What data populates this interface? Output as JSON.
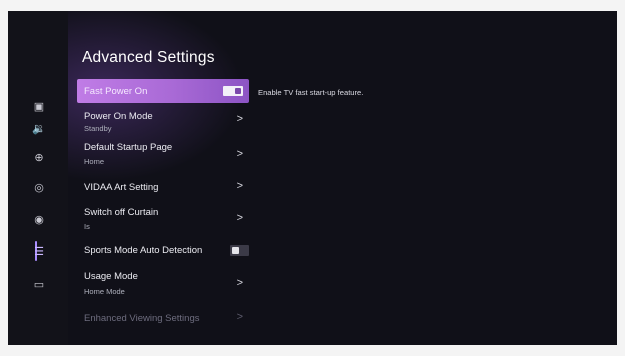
{
  "page": {
    "title": "Advanced Settings",
    "help_text": "Enable TV fast start-up feature."
  },
  "sidebar": {
    "items": [
      {
        "name": "picture",
        "icon": "picture-icon",
        "glyph": "▣"
      },
      {
        "name": "sound",
        "icon": "speaker-icon",
        "glyph": "🔉"
      },
      {
        "name": "network",
        "icon": "globe-icon",
        "glyph": "⊕"
      },
      {
        "name": "general",
        "icon": "compass-icon",
        "glyph": "◎"
      },
      {
        "name": "support",
        "icon": "support-icon",
        "glyph": "◉"
      },
      {
        "name": "system",
        "icon": "list-icon",
        "glyph": "☰"
      },
      {
        "name": "display",
        "icon": "monitor-icon",
        "glyph": "▭"
      }
    ],
    "active_index": 5
  },
  "settings": [
    {
      "label": "Fast Power On",
      "sub": "",
      "control": "toggle",
      "toggle_on": true,
      "focused": true
    },
    {
      "label": "Power On Mode",
      "sub": "Standby",
      "control": "chevron",
      "chevron": ">"
    },
    {
      "label": "Default Startup Page",
      "sub": "Home",
      "control": "chevron",
      "chevron": ">"
    },
    {
      "label": "VIDAA Art Setting",
      "sub": "",
      "control": "chevron",
      "chevron": ">"
    },
    {
      "label": "Switch off Curtain",
      "sub": "Is",
      "control": "chevron",
      "chevron": ">"
    },
    {
      "label": "Sports Mode Auto Detection",
      "sub": "",
      "control": "toggle",
      "toggle_on": false
    },
    {
      "label": "Usage Mode",
      "sub": "Home Mode",
      "control": "chevron",
      "chevron": ">"
    },
    {
      "label": "Enhanced Viewing Settings",
      "sub": "",
      "control": "chevron",
      "chevron": ">",
      "dim": true
    }
  ],
  "colors": {
    "focus_start": "#c07ce6",
    "focus_end": "#8c54c4",
    "background": "#101018",
    "accent": "#a98dff"
  }
}
